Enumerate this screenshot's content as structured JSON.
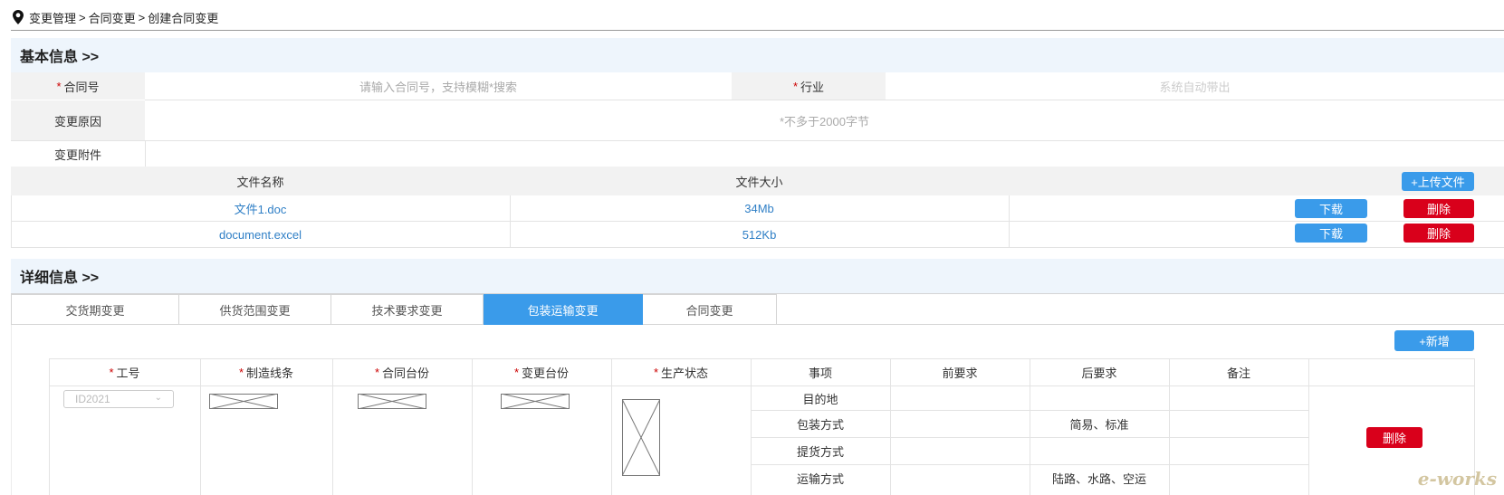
{
  "breadcrumb": {
    "items": [
      "变更管理",
      "合同变更",
      "创建合同变更"
    ],
    "separator": ">"
  },
  "basic": {
    "title": "基本信息 >>",
    "contract_no_label": "合同号",
    "contract_no_placeholder": "请输入合同号，支持模糊*搜索",
    "industry_label": "行业",
    "industry_placeholder": "系统自动带出",
    "reason_label": "变更原因",
    "reason_placeholder": "*不多于2000字节",
    "attachment_label": "变更附件",
    "file_col_name": "文件名称",
    "file_col_size": "文件大小",
    "upload_label": "+上传文件",
    "files": [
      {
        "name": "文件1.doc",
        "size": "34Mb",
        "download": "下载",
        "delete": "删除"
      },
      {
        "name": "document.excel",
        "size": "512Kb",
        "download": "下载",
        "delete": "删除"
      }
    ]
  },
  "detail": {
    "title": "详细信息 >>",
    "tabs": [
      "交货期变更",
      "供货范围变更",
      "技术要求变更",
      "包装运输变更",
      "合同变更"
    ],
    "active_tab": "包装运输变更",
    "add_label": "+新增",
    "columns": [
      "工号",
      "制造线条",
      "合同台份",
      "变更台份",
      "生产状态",
      "事项",
      "前要求",
      "后要求",
      "备注"
    ],
    "required_columns": [
      "工号",
      "制造线条",
      "合同台份",
      "变更台份",
      "生产状态"
    ],
    "row": {
      "job_no": "ID2021",
      "items": [
        {
          "name": "目的地",
          "after": ""
        },
        {
          "name": "包装方式",
          "after": "简易、标准"
        },
        {
          "name": "提货方式",
          "after": ""
        },
        {
          "name": "运输方式",
          "after": "陆路、水路、空运"
        }
      ],
      "delete_label": "删除"
    }
  },
  "watermark": "e-works",
  "colors": {
    "accent": "#3a9bea",
    "danger": "#d9001b",
    "section_bg": "#eef5fc",
    "label_bg": "#f2f2f2",
    "link": "#2f7fc6"
  }
}
